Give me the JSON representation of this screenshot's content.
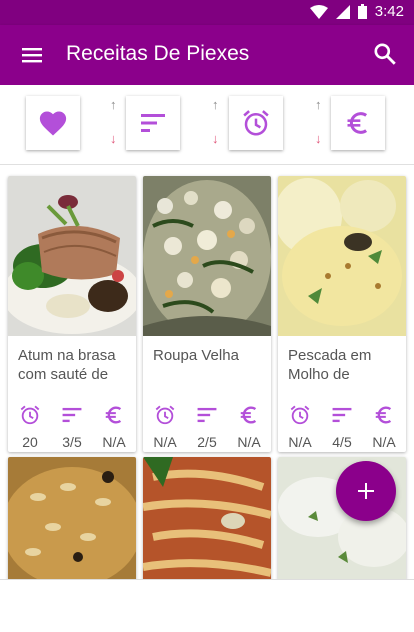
{
  "status": {
    "time": "3:42"
  },
  "appbar": {
    "title": "Receitas De Piexes"
  },
  "icons": {
    "menu": "menu-icon",
    "search": "search-icon",
    "favorite": "heart-icon",
    "sort": "sort-icon",
    "time": "alarm-clock-icon",
    "price": "euro-icon",
    "add": "plus-icon"
  },
  "colors": {
    "primary": "#8b008b",
    "accent": "#b34fd9",
    "down_arrow": "#e0567a"
  },
  "filters": {
    "up_arrow": "↑",
    "down_arrow": "↓"
  },
  "cards": [
    {
      "name": "Atum na brasa com sauté de",
      "time": "20 min.",
      "difficulty": "3/5",
      "price": "N/A"
    },
    {
      "name": "Roupa Velha",
      "time": "N/A",
      "difficulty": "2/5",
      "price": "N/A"
    },
    {
      "name": "Pescada em Molho de",
      "time": "N/A",
      "difficulty": "4/5",
      "price": "N/A"
    }
  ],
  "fab": {
    "label": "+"
  }
}
